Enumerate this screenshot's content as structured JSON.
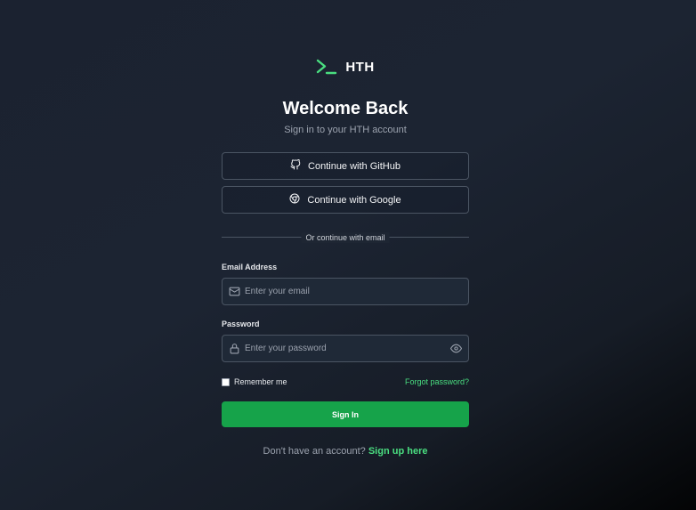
{
  "brand": {
    "name": "HTH",
    "accent": "#4ade80",
    "icon": "terminal-prompt-icon"
  },
  "header": {
    "title": "Welcome Back",
    "subtitle": "Sign in to your HTH account"
  },
  "oauth": {
    "github_label": "Continue with GitHub",
    "google_label": "Continue with Google"
  },
  "divider": {
    "text": "Or continue with email"
  },
  "form": {
    "email": {
      "label": "Email Address",
      "placeholder": "Enter your email",
      "value": ""
    },
    "password": {
      "label": "Password",
      "placeholder": "Enter your password",
      "value": ""
    },
    "remember_label": "Remember me",
    "remember_checked": false,
    "forgot_label": "Forgot password?",
    "submit_label": "Sign In"
  },
  "footer": {
    "prompt": "Don't have an account?",
    "link": "Sign up here"
  },
  "colors": {
    "primary_button": "#16a34a",
    "link": "#4ade80",
    "border": "#4b5563"
  }
}
